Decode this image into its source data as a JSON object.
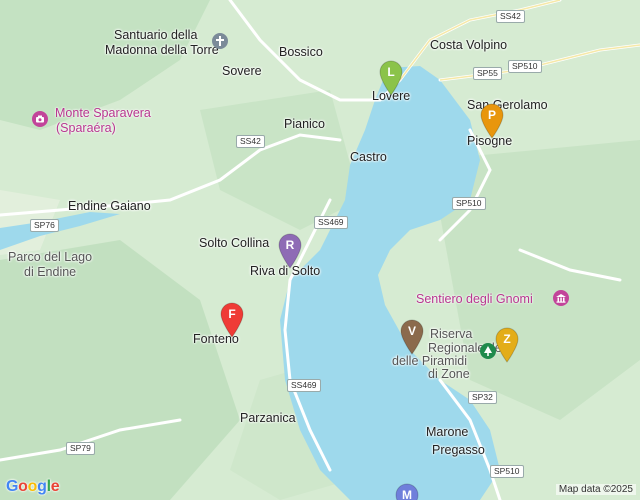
{
  "places": [
    {
      "id": "santuario-1",
      "text": "Santuario della"
    },
    {
      "id": "santuario-2",
      "text": "Madonna della Torre"
    },
    {
      "id": "bossico",
      "text": "Bossico"
    },
    {
      "id": "sovere",
      "text": "Sovere"
    },
    {
      "id": "costa-volpino",
      "text": "Costa Volpino"
    },
    {
      "id": "lovere",
      "text": "Lovere"
    },
    {
      "id": "san-gerolamo",
      "text": "San Gerolamo"
    },
    {
      "id": "pisogne",
      "text": "Pisogne"
    },
    {
      "id": "pianico",
      "text": "Pianico"
    },
    {
      "id": "castro",
      "text": "Castro"
    },
    {
      "id": "endine-gaiano",
      "text": "Endine Gaiano"
    },
    {
      "id": "solto-collina",
      "text": "Solto Collina"
    },
    {
      "id": "riva-di-solto",
      "text": "Riva di Solto"
    },
    {
      "id": "parco-1",
      "text": "Parco del Lago"
    },
    {
      "id": "parco-2",
      "text": "di Endine"
    },
    {
      "id": "fonteno",
      "text": "Fonteno"
    },
    {
      "id": "riserva-1",
      "text": "Riserva"
    },
    {
      "id": "riserva-2",
      "text": "Regionale delle"
    },
    {
      "id": "riserva-3",
      "text": "delle Piramidi"
    },
    {
      "id": "riserva-4",
      "text": "di Zone"
    },
    {
      "id": "parzanica",
      "text": "Parzanica"
    },
    {
      "id": "marone",
      "text": "Marone"
    },
    {
      "id": "pregasso",
      "text": "Pregasso"
    }
  ],
  "pois": {
    "monte_1": "Monte Sparavera",
    "monte_2": "(Sparaéra)",
    "gnomi": "Sentiero degli Gnomi"
  },
  "roads": [
    "SS42",
    "SP55",
    "SP510",
    "SS42",
    "SS469",
    "SP510",
    "SP76",
    "SS469",
    "SP32",
    "SP79",
    "SP510"
  ],
  "markers": [
    {
      "letter": "L",
      "color": "#8bc34a"
    },
    {
      "letter": "P",
      "color": "#e8960c"
    },
    {
      "letter": "R",
      "color": "#8e6bb5"
    },
    {
      "letter": "F",
      "color": "#ef3b36"
    },
    {
      "letter": "V",
      "color": "#8b6a4c"
    },
    {
      "letter": "Z",
      "color": "#e3ad18"
    },
    {
      "letter": "M",
      "color": "#6f7fdb"
    }
  ],
  "footer": {
    "brand": "Google",
    "attribution": "Map data ©2025"
  },
  "colors": {
    "water": "#9ed9ec",
    "land": "#d8ecd4",
    "road": "#ffffff"
  }
}
